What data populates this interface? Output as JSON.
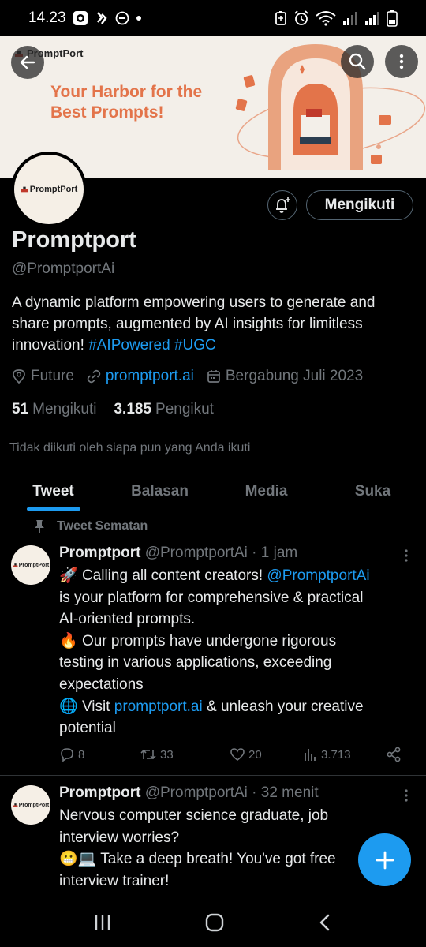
{
  "status_bar": {
    "time": "14.23"
  },
  "banner": {
    "logo_text": "PromptPort",
    "tagline": "Your Harbor for the Best Prompts!",
    "colors": {
      "background": "#f3efe9",
      "accent": "#e3744a"
    }
  },
  "profile": {
    "avatar_text": "PromptPort",
    "name": "Promptport",
    "handle": "@PromptportAi",
    "bio_text": "A dynamic platform empowering users to generate and share prompts, augmented by AI insights for limitless innovation!",
    "bio_tags": [
      "#AIPowered",
      "#UGC"
    ],
    "location": "Future",
    "website": "promptport.ai",
    "joined": "Bergabung Juli 2023",
    "following_count": "51",
    "following_label": "Mengikuti",
    "followers_count": "3.185",
    "followers_label": "Pengikut",
    "not_followed_text": "Tidak diikuti oleh siapa pun yang Anda ikuti",
    "follow_button": "Mengikuti"
  },
  "tabs": [
    {
      "label": "Tweet",
      "active": true
    },
    {
      "label": "Balasan",
      "active": false
    },
    {
      "label": "Media",
      "active": false
    },
    {
      "label": "Suka",
      "active": false
    }
  ],
  "tweets": [
    {
      "pinned_label": "Tweet Sematan",
      "avatar_text": "PromptPort",
      "name": "Promptport",
      "meta": "@PromptportAi · 1 jam",
      "lines": {
        "l1_emoji": "🚀",
        "l1_text": " Calling all content creators! ",
        "l1_mention": "@PromptportAi",
        "l2": "is your platform for comprehensive & practical",
        "l3": "AI-oriented prompts.",
        "l4_emoji": "🔥",
        "l4_text": " Our prompts have undergone rigorous",
        "l5": "testing in various applications, exceeding",
        "l6": "expectations",
        "l7_emoji": "🌐",
        "l7_text": " Visit ",
        "l7_link": "promptport.ai",
        "l7_rest": " & unleash your creative",
        "l8": "potential"
      },
      "replies": "8",
      "retweets": "33",
      "likes": "20",
      "views": "3.713"
    },
    {
      "avatar_text": "PromptPort",
      "name": "Promptport",
      "meta": "@PromptportAi · 32 menit",
      "lines": {
        "l1": "Nervous computer science graduate, job",
        "l2": "interview worries?",
        "l3_emoji": "😬💻",
        "l3_text": " Take a deep breath! You've got free",
        "l4": "interview trainer!"
      }
    }
  ],
  "accent_color": "#1d9bf0"
}
